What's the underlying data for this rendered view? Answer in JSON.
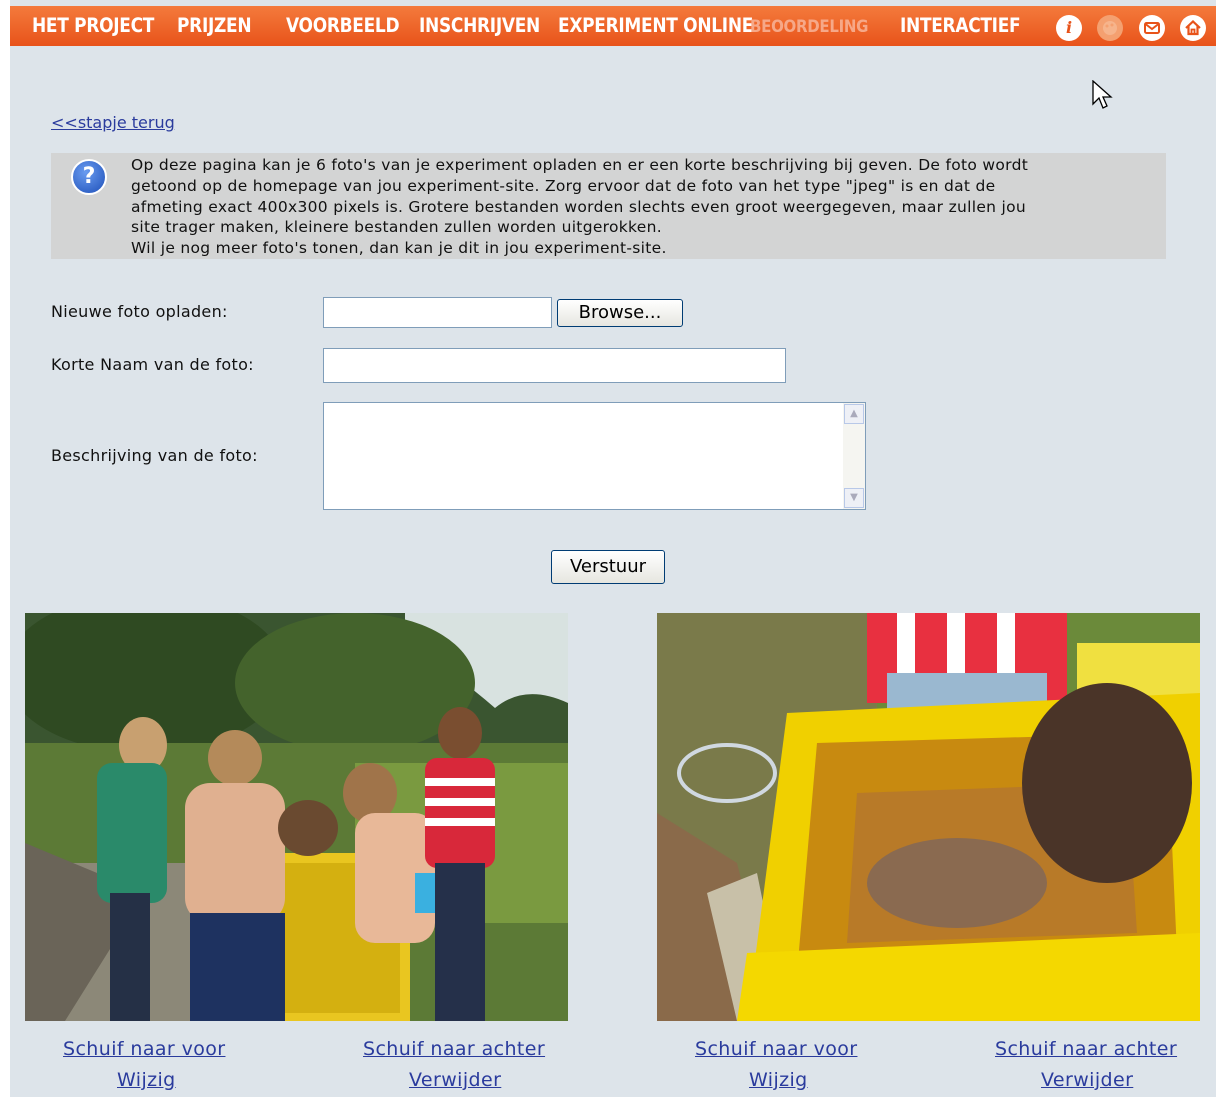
{
  "nav": {
    "items": [
      "HET PROJECT",
      "PRIJZEN",
      "VOORBEELD",
      "INSCHRIJVEN",
      "EXPERIMENT ONLINE",
      "BEOORDELING",
      "INTERACTIEF"
    ],
    "info_icon": "i"
  },
  "back_link": "<<stapje terug",
  "info": {
    "help_icon": "?",
    "lines": [
      "Op deze pagina kan je 6 foto's van je experiment opladen en er een korte beschrijving bij geven. De foto wordt",
      "getoond op de homepage van jou experiment-site. Zorg ervoor dat de foto van het type \"jpeg\" is en dat de",
      "afmeting exact 400x300 pixels is. Grotere bestanden worden slechts even groot weergegeven, maar zullen jou",
      "site trager maken, kleinere bestanden zullen worden uitgerokken.",
      "Wil je nog meer foto's tonen, dan kan je dit in jou experiment-site."
    ]
  },
  "form": {
    "upload_label": "Nieuwe foto opladen:",
    "browse_button": "Browse...",
    "name_label": "Korte Naam van de foto:",
    "description_label": "Beschrijving van de foto:",
    "submit_button": "Verstuur"
  },
  "photos": [
    {
      "move_front": "Schuif naar voor",
      "move_back": "Schuif naar achter",
      "edit": "Wijzig",
      "delete": "Verwijder"
    },
    {
      "move_front": "Schuif naar voor",
      "move_back": "Schuif naar achter",
      "edit": "Wijzig",
      "delete": "Verwijder"
    }
  ],
  "colors": {
    "nav_bg": "#e8531a",
    "page_bg": "#dde4ea",
    "link": "#2a3b9d",
    "info_bg": "#d3d4d4"
  }
}
